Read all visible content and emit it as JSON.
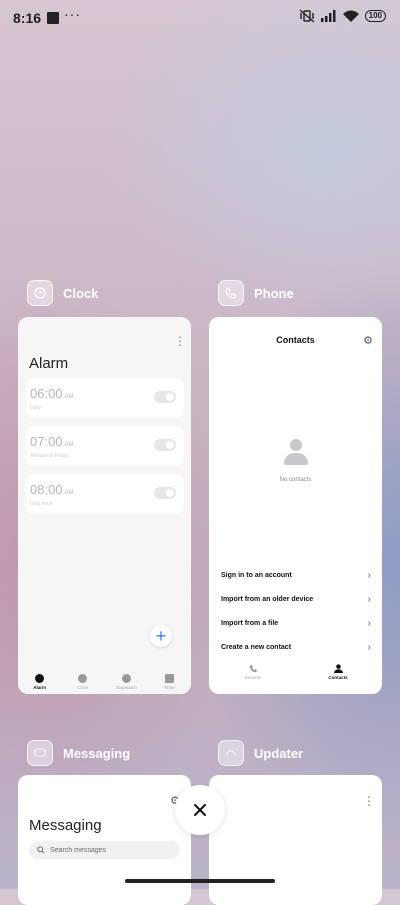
{
  "status": {
    "time": "8:16",
    "dots": "···",
    "battery": "100"
  },
  "clock_app": {
    "name": "Clock",
    "screen_title": "Alarm",
    "alarms": [
      {
        "time": "06:00",
        "ampm": "AM",
        "repeat": "Daily",
        "enabled": false
      },
      {
        "time": "07:00",
        "ampm": "AM",
        "repeat": "Monday to Friday",
        "enabled": false
      },
      {
        "time": "08:00",
        "ampm": "AM",
        "repeat": "Only once",
        "enabled": false
      }
    ],
    "nav": [
      {
        "label": "Alarm",
        "icon": "alarm-icon",
        "active": true
      },
      {
        "label": "Clock",
        "icon": "clock-icon",
        "active": false
      },
      {
        "label": "Stopwatch",
        "icon": "stopwatch-icon",
        "active": false
      },
      {
        "label": "Timer",
        "icon": "timer-icon",
        "active": false
      }
    ],
    "fab_label": "+"
  },
  "phone_app": {
    "name": "Phone",
    "screen_title": "Contacts",
    "empty_text": "No contacts",
    "options": [
      "Sign in to an account",
      "Import from an older device",
      "Import from a file",
      "Create a new contact"
    ],
    "nav": [
      {
        "label": "Recents",
        "icon": "phone-icon",
        "active": false
      },
      {
        "label": "Contacts",
        "icon": "person-icon",
        "active": true
      }
    ]
  },
  "messaging_app": {
    "name": "Messaging",
    "screen_title": "Messaging",
    "search_placeholder": "Search messages"
  },
  "updater_app": {
    "name": "Updater"
  },
  "colors": {
    "accent_blue": "#2f7ff0"
  }
}
